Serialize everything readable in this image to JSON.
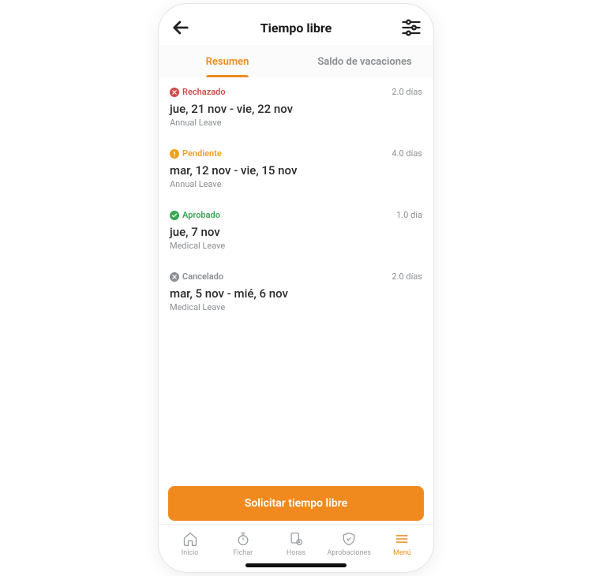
{
  "header": {
    "title": "Tiempo libre"
  },
  "tabs": {
    "summary": "Resumen",
    "balance": "Saldo de vacaciones"
  },
  "requests": [
    {
      "status_key": "rechazado",
      "status_label": "Rechazado",
      "days": "2.0 días",
      "range": "jue, 21 nov - vie, 22 nov",
      "type": "Annual Leave"
    },
    {
      "status_key": "pendiente",
      "status_label": "Pendiente",
      "days": "4.0 días",
      "range": "mar, 12 nov - vie, 15 nov",
      "type": "Annual Leave"
    },
    {
      "status_key": "aprobado",
      "status_label": "Aprobado",
      "days": "1.0 día",
      "range": "jue, 7 nov",
      "type": "Medical Leave"
    },
    {
      "status_key": "cancelado",
      "status_label": "Cancelado",
      "days": "2.0 días",
      "range": "mar, 5 nov - mié, 6 nov",
      "type": "Medical Leave"
    }
  ],
  "footer": {
    "request_button": "Solicitar tiempo libre"
  },
  "nav": {
    "home": "Inicio",
    "clock": "Fichar",
    "hours": "Horas",
    "approv": "Aprobaciones",
    "menu": "Menú"
  },
  "colors": {
    "accent": "#f08a1f"
  }
}
